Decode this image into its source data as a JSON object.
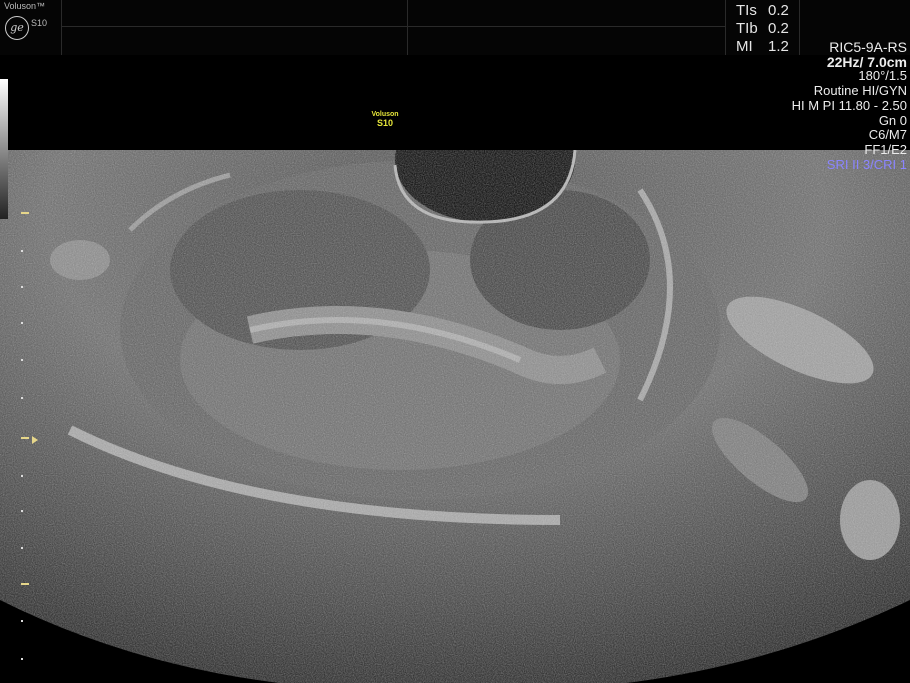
{
  "header": {
    "brand": "Voluson™",
    "model": "S10",
    "metrics": [
      {
        "key": "TIs",
        "value": "0.2"
      },
      {
        "key": "TIb",
        "value": "0.2"
      },
      {
        "key": "MI",
        "value": "1.2"
      }
    ]
  },
  "params": {
    "probe": "RIC5-9A-RS",
    "frequency_depth": "22Hz/ 7.0cm",
    "angle": "180°/1.5",
    "preset": "Routine HI/GYN",
    "mode": "HI M PI 11.80 - 2.50",
    "gain": "Gn  0",
    "cm": "C6/M7",
    "ff": "FF1/E2",
    "sri": "SRI II 3/CRI 1"
  },
  "image_label": {
    "brand": "Voluson",
    "model": "S10"
  }
}
